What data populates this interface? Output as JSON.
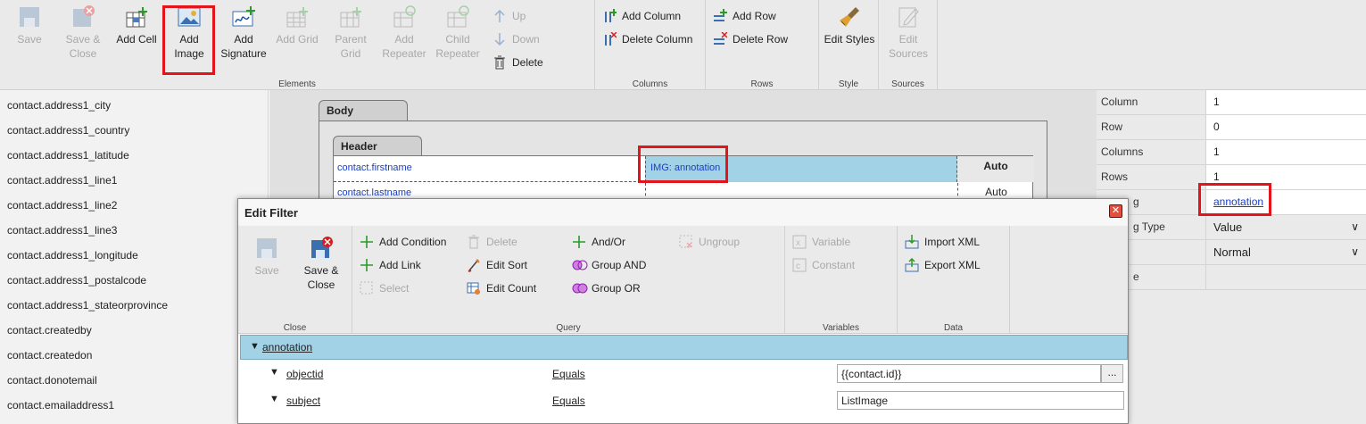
{
  "ribbon": {
    "elements": {
      "label": "Elements",
      "buttons": {
        "save": [
          "Save"
        ],
        "save_close": [
          "Save &",
          "Close"
        ],
        "add_cell": [
          "Add Cell"
        ],
        "add_image": [
          "Add",
          "Image"
        ],
        "add_signature": [
          "Add",
          "Signature"
        ],
        "add_grid": [
          "Add Grid"
        ],
        "parent_grid": [
          "Parent",
          "Grid"
        ],
        "add_repeater": [
          "Add",
          "Repeater"
        ],
        "child_repeater": [
          "Child",
          "Repeater"
        ],
        "up": "Up",
        "down": "Down",
        "delete": "Delete"
      }
    },
    "columns": {
      "label": "Columns",
      "add": "Add Column",
      "delete": "Delete Column"
    },
    "rows": {
      "label": "Rows",
      "add": "Add Row",
      "delete": "Delete Row"
    },
    "style": {
      "label": "Style",
      "edit": "Edit Styles"
    },
    "sources": {
      "label": "Sources",
      "edit": [
        "Edit",
        "Sources"
      ]
    }
  },
  "fields": [
    "contact.address1_city",
    "contact.address1_country",
    "contact.address1_latitude",
    "contact.address1_line1",
    "contact.address1_line2",
    "contact.address1_line3",
    "contact.address1_longitude",
    "contact.address1_postalcode",
    "contact.address1_stateorprovince",
    "contact.createdby",
    "contact.createdon",
    "contact.donotemail",
    "contact.emailaddress1"
  ],
  "canvas": {
    "body_tab": "Body",
    "header_tab": "Header",
    "row1": {
      "field": "contact.firstname",
      "image": "IMG: annotation",
      "width": "Auto"
    },
    "row2": {
      "field": "contact.lastname",
      "width": "Auto"
    }
  },
  "properties": {
    "column": {
      "key": "Column",
      "value": "1"
    },
    "row": {
      "key": "Row",
      "value": "0"
    },
    "columns": {
      "key": "Columns",
      "value": "1"
    },
    "rows": {
      "key": "Rows",
      "value": "1"
    },
    "img": {
      "key": "g",
      "value": "annotation"
    },
    "binding": {
      "key": "g Type",
      "value": "Value"
    },
    "size": {
      "key": "",
      "value": "Normal"
    },
    "last": {
      "key": "e",
      "value": ""
    }
  },
  "dialog": {
    "title": "Edit Filter",
    "close": {
      "label": "Close",
      "save": "Save",
      "save_close": [
        "Save &",
        "Close"
      ]
    },
    "query": {
      "label": "Query",
      "add_condition": "Add Condition",
      "add_link": "Add Link",
      "select": "Select",
      "delete": "Delete",
      "edit_sort": "Edit Sort",
      "edit_count": "Edit Count",
      "and_or": "And/Or",
      "group_and": "Group AND",
      "group_or": "Group OR",
      "ungroup": "Ungroup"
    },
    "variables": {
      "label": "Variables",
      "variable": "Variable",
      "constant": "Constant"
    },
    "data": {
      "label": "Data",
      "import": "Import XML",
      "export": "Export XML"
    },
    "tree": {
      "entity": "annotation",
      "conditions": [
        {
          "field": "objectid",
          "operator": "Equals",
          "value": "{{contact.id}}"
        },
        {
          "field": "subject",
          "operator": "Equals",
          "value": "ListImage"
        }
      ],
      "ellipsis": "..."
    }
  },
  "colors": {
    "highlight": "#e4141b",
    "accent": "#a2d2e6",
    "link": "#1a3fbf"
  }
}
